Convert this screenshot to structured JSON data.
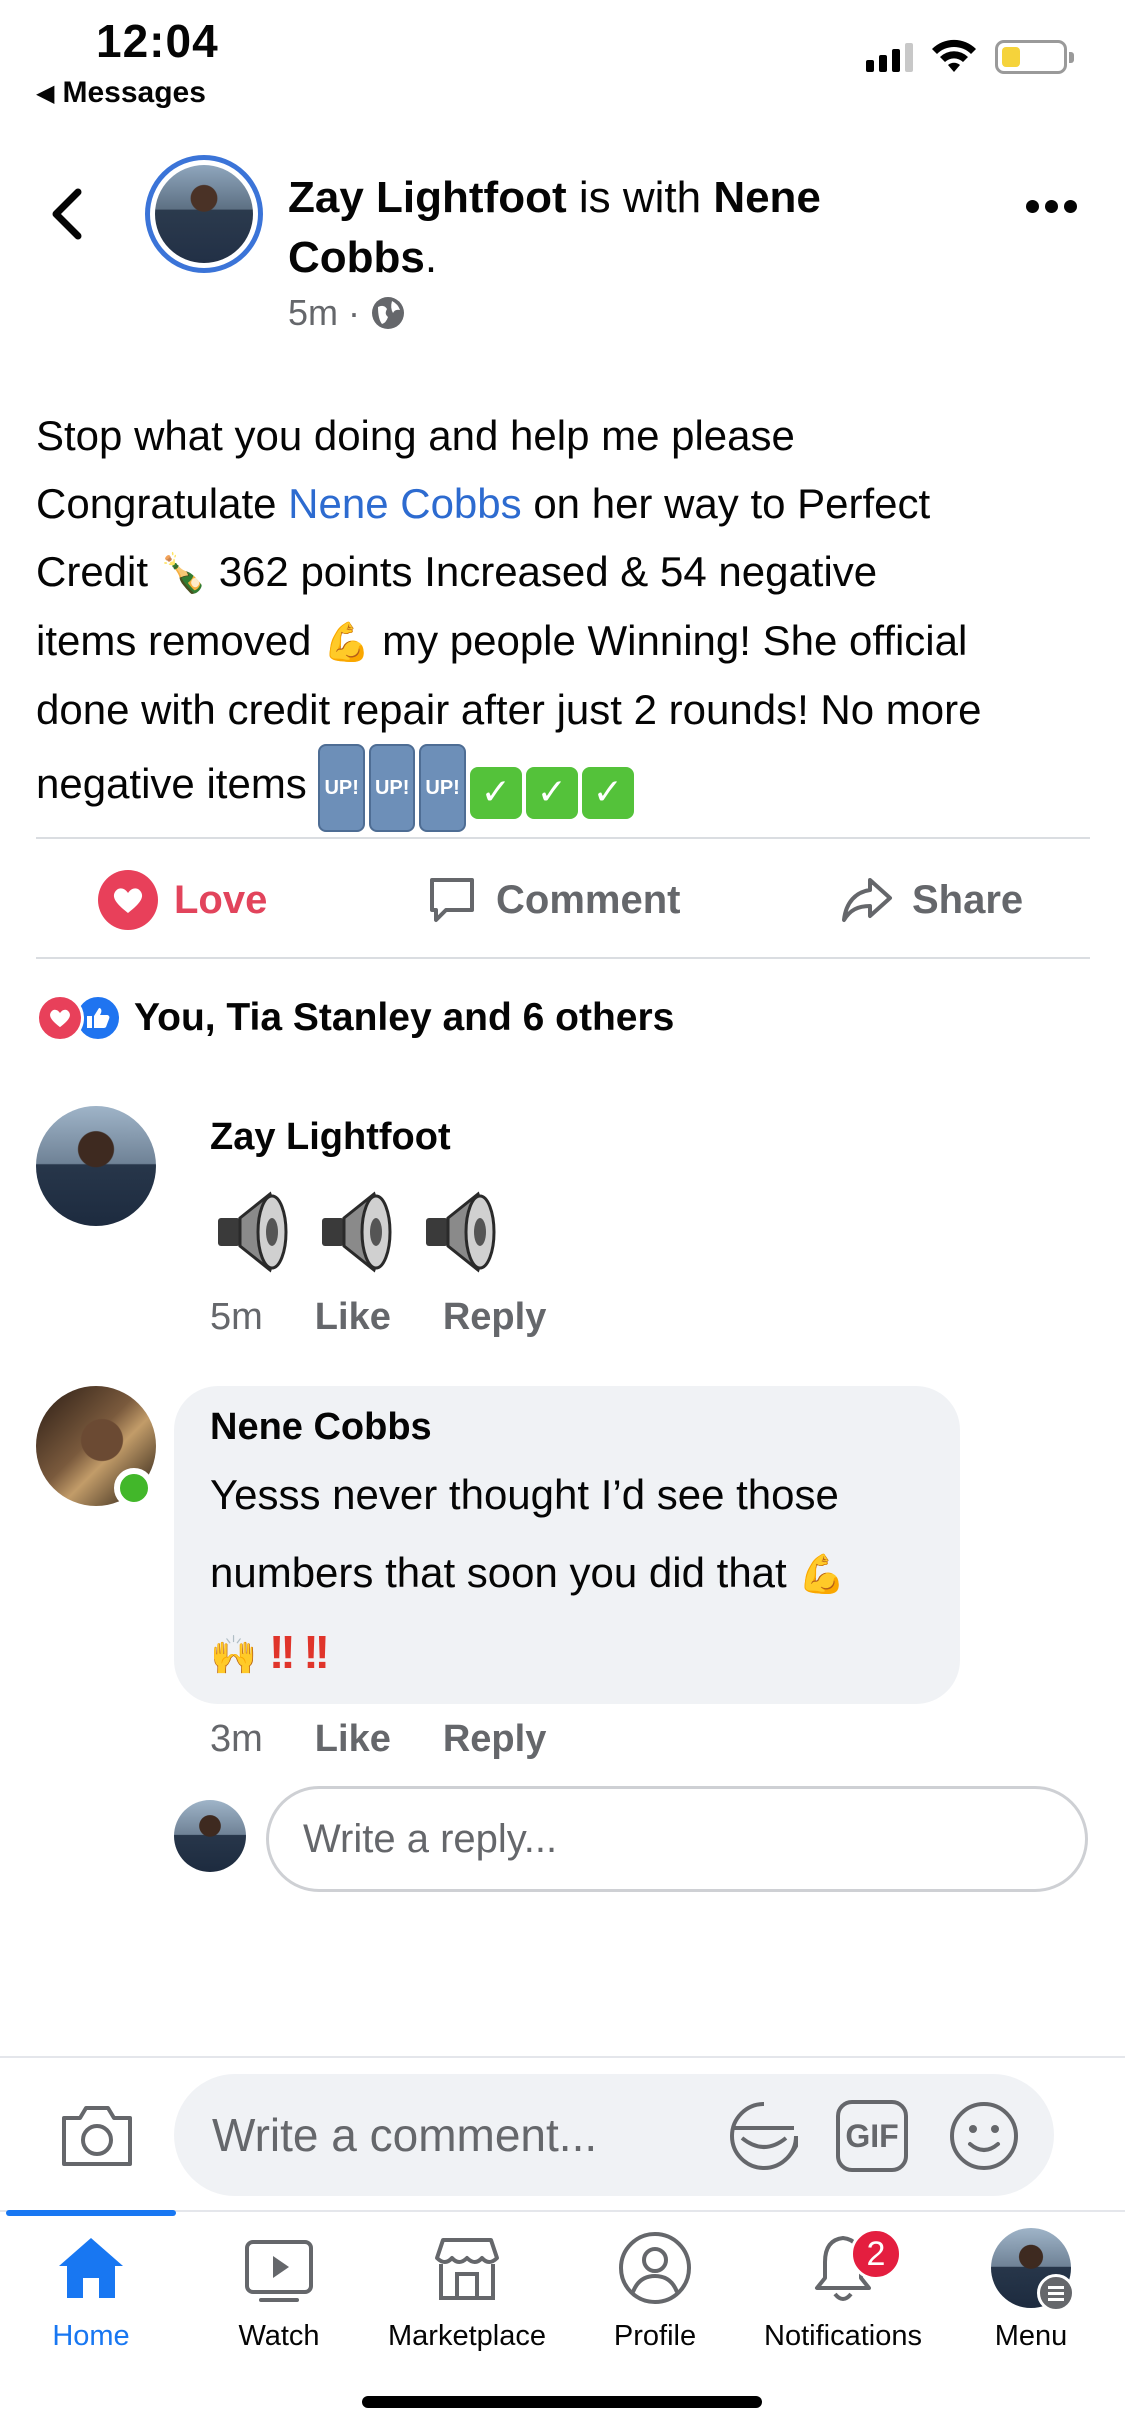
{
  "status_bar": {
    "time": "12:04",
    "back_app": "Messages"
  },
  "post": {
    "author": "Zay Lightfoot",
    "with_text": " is with ",
    "tagged": "Nene Cobbs",
    "header_end": ".",
    "time": "5m",
    "separator": "·",
    "body": {
      "line1": "Stop what you doing and help me please",
      "congrats": "Congratulate ",
      "tag": "Nene Cobbs",
      "after_tag": " on her way to Perfect",
      "credit": "Credit ",
      "bottle": "🍾",
      "points": " 362 points Increased & 54 negative",
      "removed": "items removed ",
      "muscle": "💪",
      "winning": " my people Winning! She official",
      "done": "done with credit repair after just 2 rounds! No more",
      "negative": "negative items ",
      "up_badge": "UP!",
      "check": "✓"
    }
  },
  "actions": {
    "love": "Love",
    "comment": "Comment",
    "share": "Share"
  },
  "reactions": {
    "summary": "You, Tia Stanley and 6 others"
  },
  "comments": [
    {
      "author": "Zay Lightfoot",
      "time": "5m",
      "like": "Like",
      "reply": "Reply"
    },
    {
      "author": "Nene Cobbs",
      "line1": "Yesss never thought I’d see those",
      "line2": "numbers that soon you did that ",
      "muscle": "💪",
      "hands": "🙌",
      "bangs": "!!",
      "time": "3m",
      "like": "Like",
      "reply": "Reply"
    }
  ],
  "reply_box": {
    "placeholder": "Write a reply..."
  },
  "composer": {
    "placeholder": "Write a comment...",
    "gif": "GIF"
  },
  "tabs": [
    {
      "label": "Home"
    },
    {
      "label": "Watch"
    },
    {
      "label": "Marketplace"
    },
    {
      "label": "Profile"
    },
    {
      "label": "Notifications",
      "badge": "2"
    },
    {
      "label": "Menu"
    }
  ],
  "colors": {
    "accent": "#1877f2",
    "love": "#e2445c",
    "link": "#2d6bd0",
    "online": "#42b72a",
    "badge": "#e41e3f"
  }
}
